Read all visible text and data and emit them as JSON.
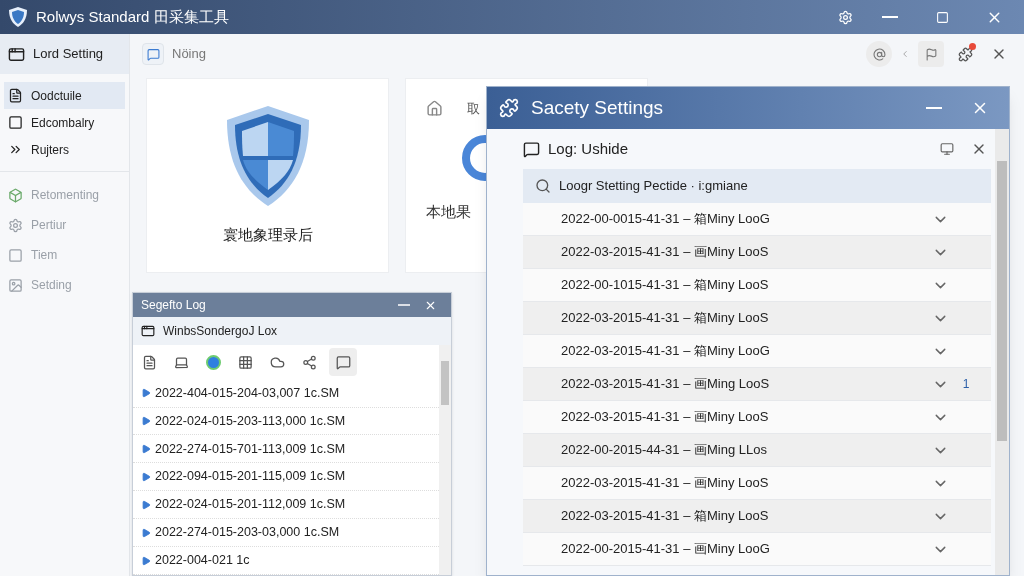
{
  "window": {
    "title": "Rolwys Standard 田采集工具"
  },
  "sidebar": {
    "header": "Lord Setting",
    "items": [
      {
        "label": "Oodctuile",
        "selected": true,
        "disabled": false,
        "kind": "doc"
      },
      {
        "label": "Edcombalry",
        "selected": false,
        "disabled": false,
        "kind": "frame"
      },
      {
        "label": "Rujters",
        "selected": false,
        "disabled": false,
        "kind": "chevrons"
      },
      {
        "label": "Retomenting",
        "selected": false,
        "disabled": true,
        "kind": "cube"
      },
      {
        "label": "Pertiur",
        "selected": false,
        "disabled": true,
        "kind": "gear"
      },
      {
        "label": "Tiem",
        "selected": false,
        "disabled": true,
        "kind": "frame"
      },
      {
        "label": "Setding",
        "selected": false,
        "disabled": true,
        "kind": "image"
      }
    ]
  },
  "toolbar": {
    "tab": "Nöing"
  },
  "cards": [
    {
      "kind": "shield",
      "label": "寰地象理录后"
    },
    {
      "kind": "circle",
      "heading": "取",
      "label": "本地果"
    }
  ],
  "log_window": {
    "title": "Segefto Log",
    "subtitle": "WinbsSondergoJ Lox",
    "entries": [
      "2022-404-015-204-03,007 1c.SM",
      "2022-024-015-203-113,000 1c.SM",
      "2022-274-015-701-113,009 1c.SM",
      "2022-094-015-201-115,009 1c.SM",
      "2022-024-015-201-112,009 1c.SM",
      "2022-274-015-203-03,000 1c.SM",
      "2022-004-021 1c"
    ]
  },
  "dialog": {
    "title": "Sacety Settings",
    "subtitle": "Log: Ushide",
    "search": "Loogr Stetting Pectide · i:gmiane",
    "rows": [
      {
        "text": "2022-00-0015-41-31 – 箱Miny LooG"
      },
      {
        "text": "2022-03-2015-41-31 – 画Miny LooS"
      },
      {
        "text": "2022-00-1015-41-31 – 箱Miny LooS"
      },
      {
        "text": "2022-03-2015-41-31 – 箱Miny LooS"
      },
      {
        "text": "2022-03-2015-41-31 – 箱Miny LooG"
      },
      {
        "text": "2022-03-2015-41-31 – 画Ming LooS",
        "count": "1"
      },
      {
        "text": "2022-03-2015-41-31 – 画Miny LooS"
      },
      {
        "text": "2022-00-2015-44-31 – 画Ming LLos"
      },
      {
        "text": "2022-03-2015-41-31 – 画Miny LooS"
      },
      {
        "text": "2022-03-2015-41-31 – 箱Miny LooS"
      },
      {
        "text": "2022-00-2015-41-31 – 画Miny LooG"
      }
    ]
  }
}
